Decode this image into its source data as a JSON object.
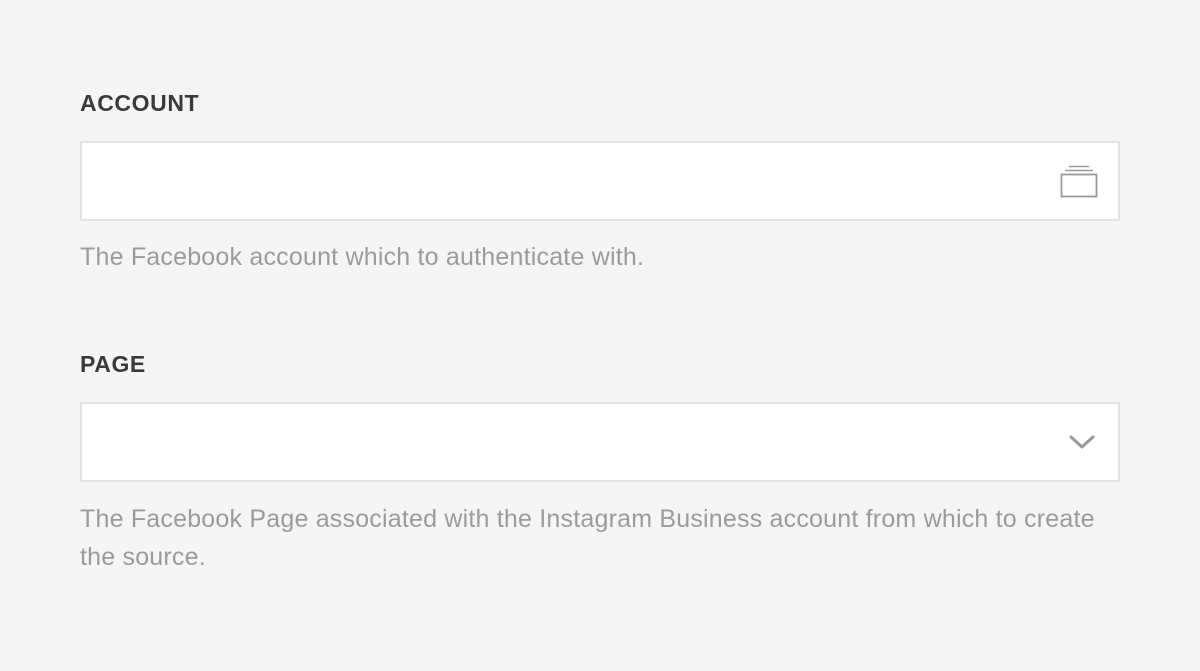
{
  "account": {
    "label": "ACCOUNT",
    "value": "",
    "icon": "picker-icon",
    "help": "The Facebook account which to authenticate with."
  },
  "page": {
    "label": "PAGE",
    "value": "",
    "icon": "chevron-down-icon",
    "help": "The Facebook Page associated with the Instagram Business account from which to create the source."
  },
  "colors": {
    "background": "#f5f5f5",
    "field_background": "#ffffff",
    "field_border": "#e3e3e3",
    "label": "#3a3a3a",
    "help_text": "#9b9b9b",
    "icon": "#9a9a9a"
  }
}
